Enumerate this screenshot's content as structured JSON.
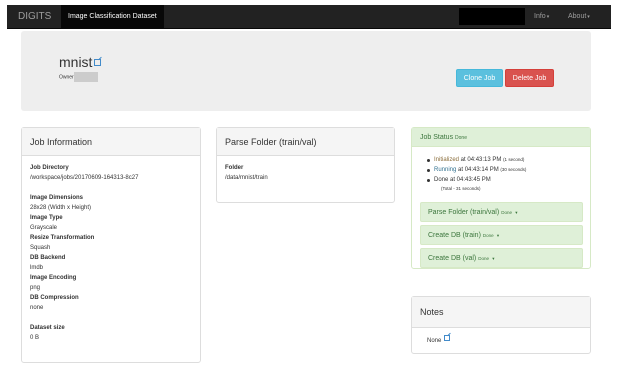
{
  "nav": {
    "brand": "DIGITS",
    "active_tab": "Image Classification Dataset",
    "info": "Info",
    "about": "About"
  },
  "job": {
    "name": "mnist",
    "owner_label": "Owner",
    "clone_button": "Clone Job",
    "delete_button": "Delete Job"
  },
  "info_panel": {
    "title": "Job Information",
    "directory_label": "Job Directory",
    "directory_value": "/workspace/jobs/20170609-164313-8c27",
    "dimensions_label": "Image Dimensions",
    "dimensions_value": "28x28 (Width x Height)",
    "type_label": "Image Type",
    "type_value": "Grayscale",
    "resize_label": "Resize Transformation",
    "resize_value": "Squash",
    "backend_label": "DB Backend",
    "backend_value": "lmdb",
    "encoding_label": "Image Encoding",
    "encoding_value": "png",
    "compression_label": "DB Compression",
    "compression_value": "none",
    "size_label": "Dataset size",
    "size_value": "0 B"
  },
  "parse_panel": {
    "title": "Parse Folder (train/val)",
    "folder_label": "Folder",
    "folder_value": "/data/mnist/train"
  },
  "status_panel": {
    "title": "Job Status",
    "state": "Done",
    "initialized_label": "Initialized",
    "initialized_time": " at 04:43:13 PM",
    "initialized_dur": "(1 second)",
    "running_label": "Running",
    "running_time": " at 04:43:14 PM",
    "running_dur": "(30 seconds)",
    "done_label": "Done",
    "done_time": " at 04:43:45 PM",
    "total": "(Total - 31 seconds)",
    "sub1": "Parse Folder (train/val)",
    "sub1_state": "Done",
    "sub2": "Create DB (train)",
    "sub2_state": "Done",
    "sub3": "Create DB (val)",
    "sub3_state": "Done"
  },
  "notes_panel": {
    "title": "Notes",
    "value": "None"
  },
  "colors": {
    "navbar": "#222222",
    "clone": "#5bc0de",
    "delete": "#d9534f",
    "success_bg": "#dff0d8",
    "success_text": "#3c763d"
  }
}
